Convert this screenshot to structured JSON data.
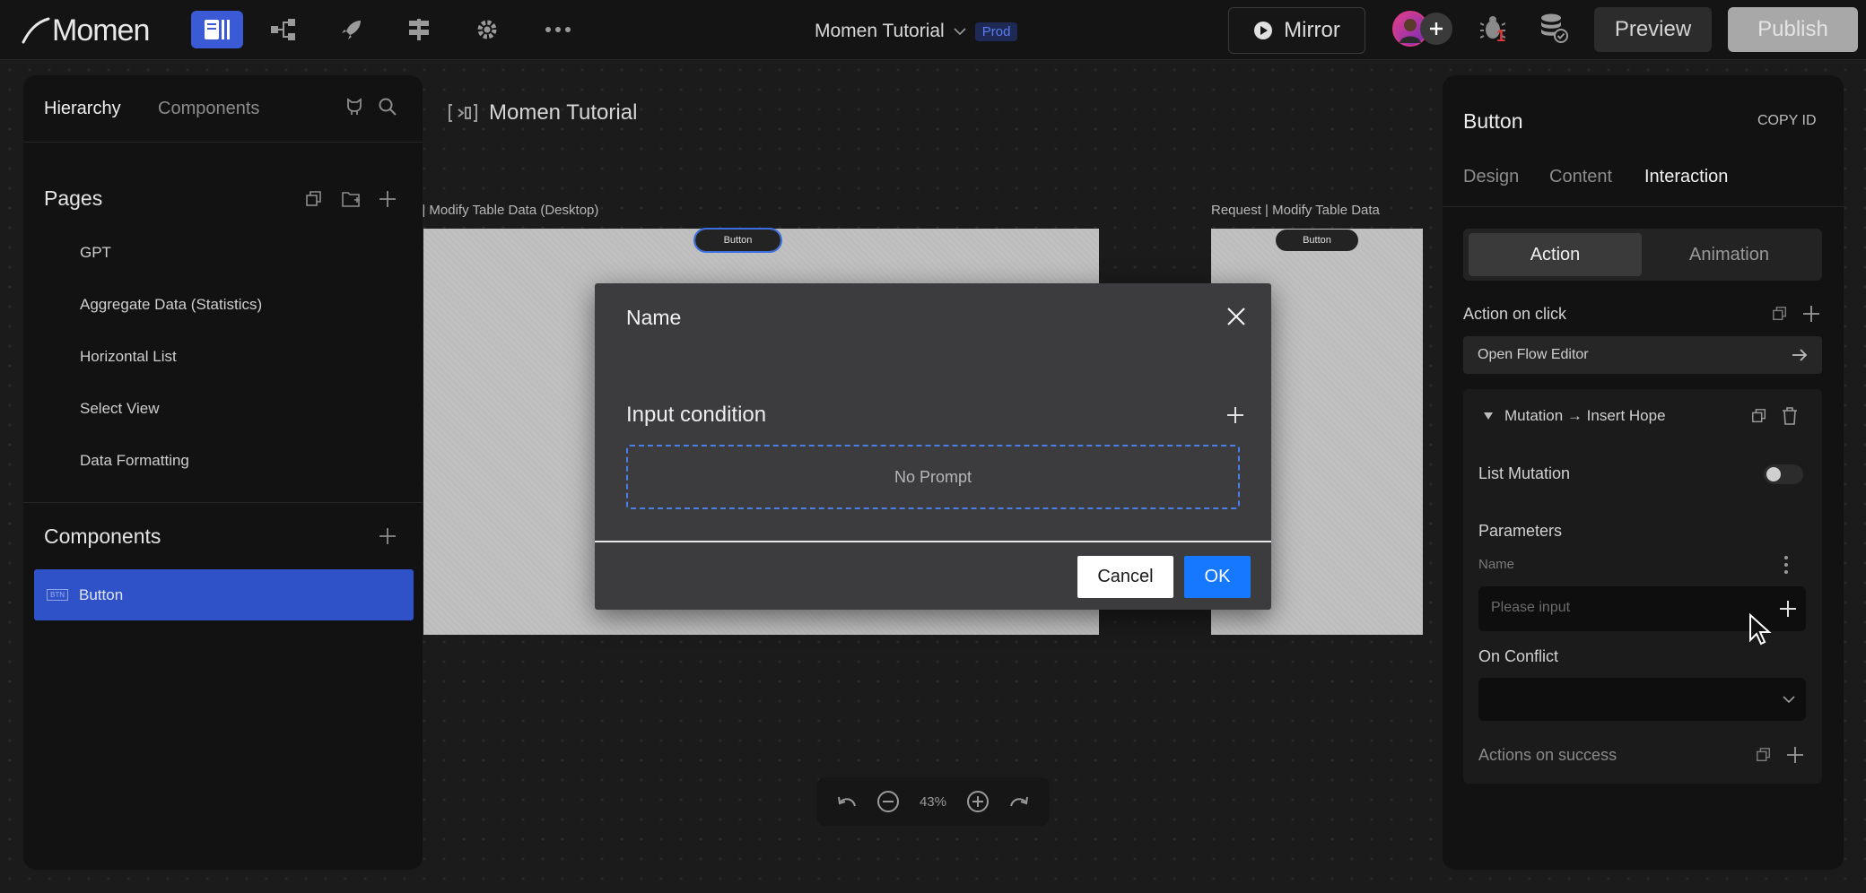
{
  "app": {
    "logo_text": "Momen",
    "project_name": "Momen Tutorial",
    "env_badge": "Prod",
    "mirror_label": "Mirror",
    "preview_label": "Preview",
    "publish_label": "Publish",
    "notification_count": "1"
  },
  "left_panel": {
    "tabs": [
      "Hierarchy",
      "Components"
    ],
    "pages_title": "Pages",
    "pages": [
      "GPT",
      "Aggregate Data (Statistics)",
      "Horizontal List",
      "Select View",
      "Data Formatting"
    ],
    "components_title": "Components",
    "components": [
      {
        "badge": "BTN",
        "label": "Button"
      }
    ]
  },
  "canvas": {
    "breadcrumb": "Momen Tutorial",
    "frame1_label": ": | Modify Table Data (Desktop)",
    "frame2_label": "Request | Modify Table Data",
    "button_text": "Button",
    "zoom": "43%"
  },
  "modal": {
    "title": "Name",
    "section_title": "Input condition",
    "empty_text": "No Prompt",
    "cancel_label": "Cancel",
    "ok_label": "OK"
  },
  "right_panel": {
    "title": "Button",
    "copy_id": "COPY ID",
    "tabs": [
      "Design",
      "Content",
      "Interaction"
    ],
    "segments": [
      "Action",
      "Animation"
    ],
    "action_on_click": "Action on click",
    "open_flow_editor": "Open Flow Editor",
    "mutation_title": "Mutation → Insert Hope",
    "list_mutation": "List Mutation",
    "parameters": "Parameters",
    "param_name": "Name",
    "param_placeholder": "Please input",
    "on_conflict": "On Conflict",
    "actions_on_success": "Actions on success"
  },
  "colors": {
    "accent": "#3b5bd6",
    "ok_blue": "#1677ff",
    "dashed_border": "#4a7fe8",
    "selected_item": "#2f52c9"
  }
}
